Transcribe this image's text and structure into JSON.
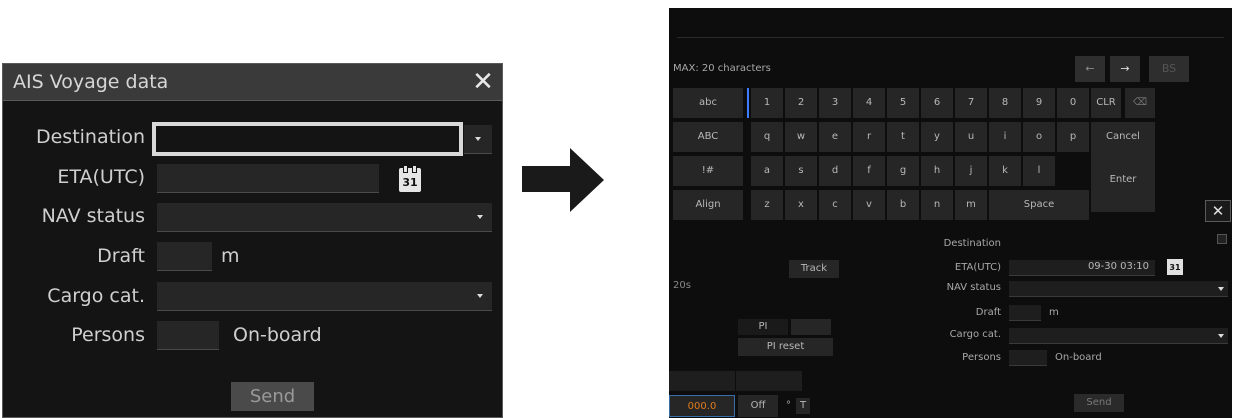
{
  "dialog": {
    "title": "AIS Voyage data",
    "close_glyph": "✕",
    "destination_label": "Destination",
    "eta_label": "ETA(UTC)",
    "nav_status_label": "NAV status",
    "draft_label": "Draft",
    "draft_unit": "m",
    "cargo_label": "Cargo cat.",
    "persons_label": "Persons",
    "persons_suffix": "On-board",
    "send_label": "Send",
    "calendar_day": "31"
  },
  "arrow": {
    "icon": "right-arrow-icon"
  },
  "screen": {
    "max_chars": "MAX: 20 characters",
    "ctrl": {
      "left": "←",
      "right": "→",
      "bs": "BS"
    },
    "keys": {
      "row1": [
        "abc",
        "1",
        "2",
        "3",
        "4",
        "5",
        "6",
        "7",
        "8",
        "9",
        "0",
        "CLR"
      ],
      "row2": [
        "ABC",
        "q",
        "w",
        "e",
        "r",
        "t",
        "y",
        "u",
        "i",
        "o",
        "p",
        "Cancel"
      ],
      "row3": [
        "!#",
        "a",
        "s",
        "d",
        "f",
        "g",
        "h",
        "j",
        "k",
        "l"
      ],
      "row4": [
        "Align",
        "z",
        "x",
        "c",
        "v",
        "b",
        "n",
        "m",
        "Space"
      ],
      "enter": "Enter",
      "clr_icon": "⌫"
    },
    "form": {
      "destination": "Destination",
      "eta": "ETA(UTC)",
      "eta_value": "09-30 03:10",
      "calendar_day": "31",
      "nav_status": "NAV status",
      "draft": "Draft",
      "draft_unit": "m",
      "cargo": "Cargo cat.",
      "persons": "Persons",
      "persons_suffix": "On-board",
      "send": "Send",
      "close_glyph": "✕"
    },
    "bg_panel": {
      "track": "Track",
      "pi": "PI",
      "pi_reset": "PI reset",
      "value": "000.0",
      "off": "Off",
      "degree": "°",
      "t": "T",
      "scale": "20s"
    }
  }
}
